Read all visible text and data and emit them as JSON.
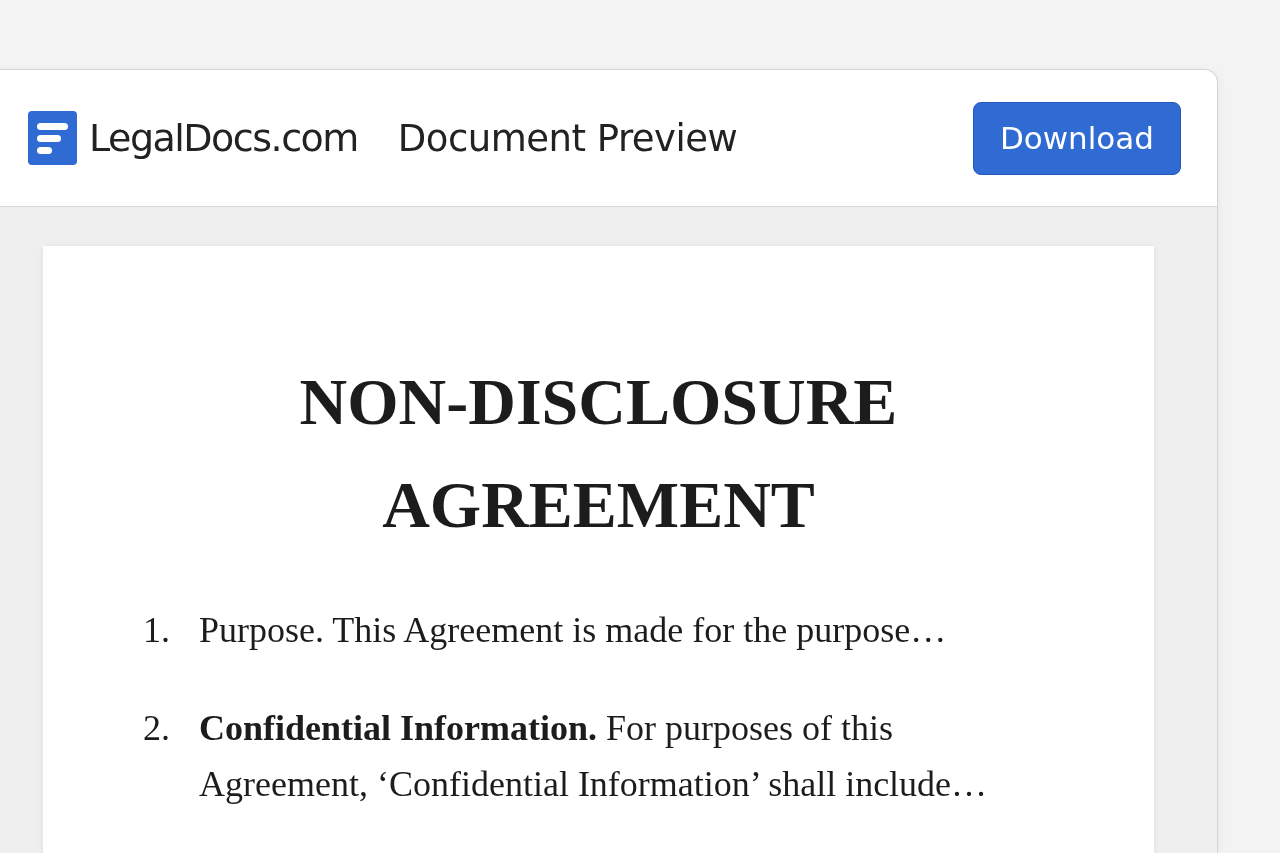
{
  "header": {
    "brand": "LegalDocs.com",
    "title": "Document Preview",
    "download_button": "Download"
  },
  "document": {
    "title": "NON-DISCLOSURE AGREEMENT",
    "clauses": [
      {
        "number": "1.",
        "text": "Purpose. This Agreement is made for the purpose…"
      },
      {
        "number": "2.",
        "text": "**Confidential Information.** For purposes of this Agreement, ‘Confidential Information’ shall include…"
      }
    ]
  }
}
